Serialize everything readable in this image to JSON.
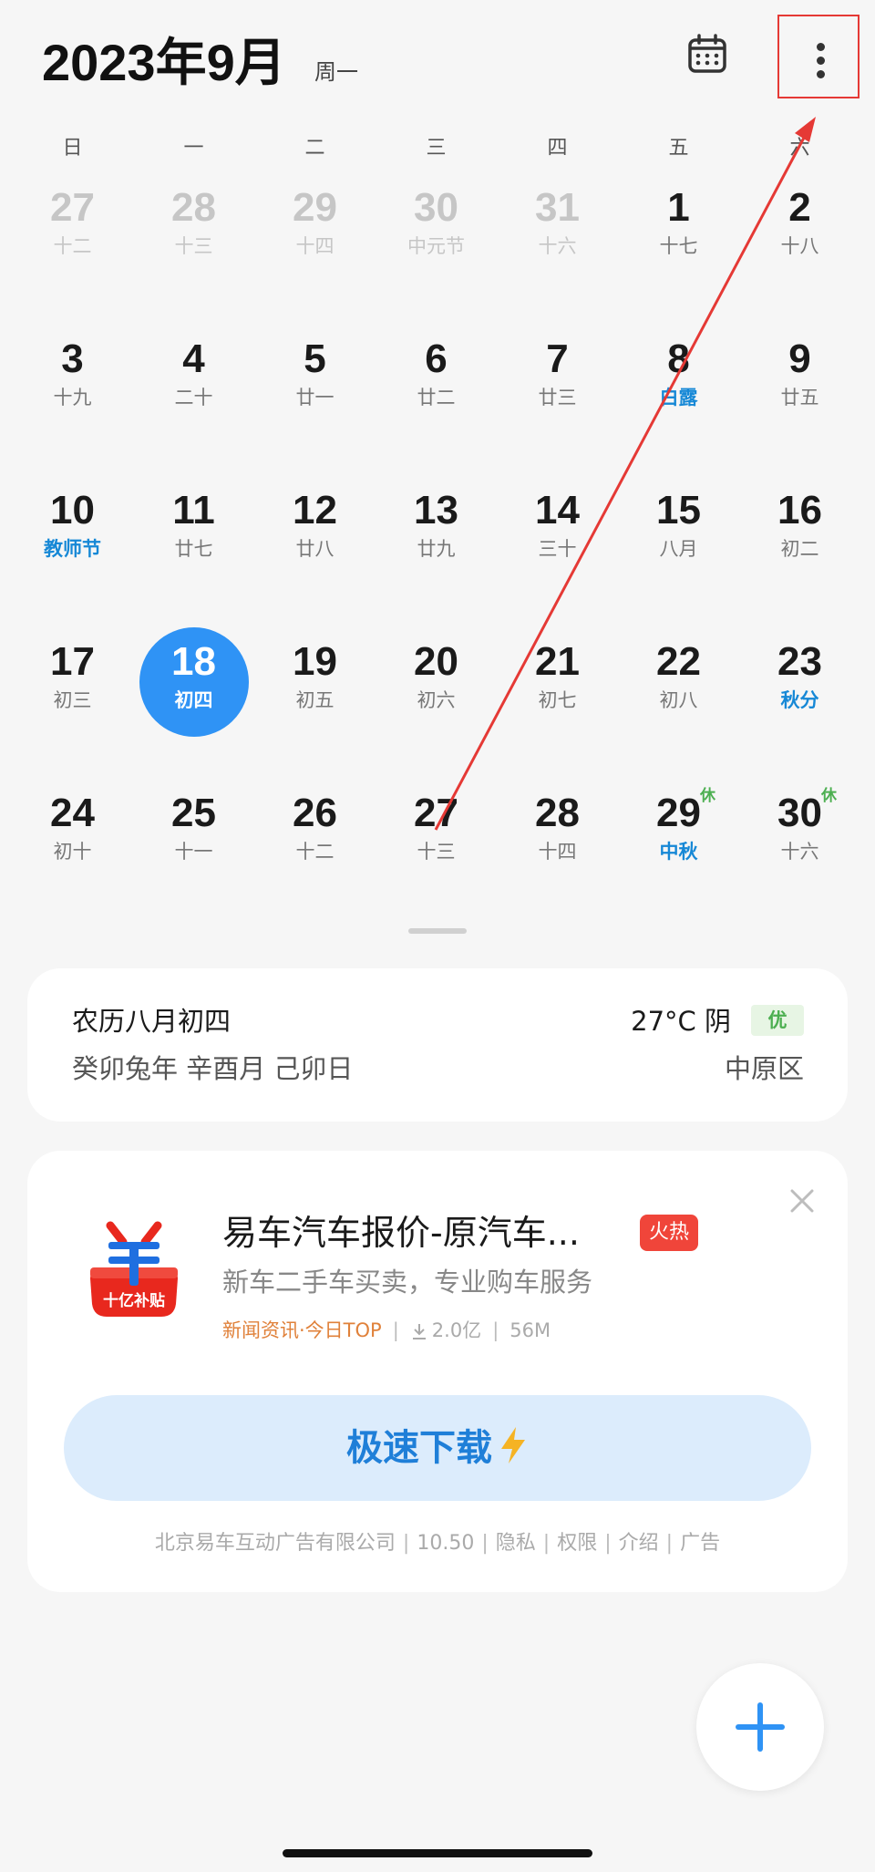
{
  "header": {
    "title": "2023年9月",
    "weekday": "周一"
  },
  "weekdays": [
    "日",
    "一",
    "二",
    "三",
    "四",
    "五",
    "六"
  ],
  "calendar": {
    "rows": [
      [
        {
          "day": "27",
          "sub": "十二",
          "out": true
        },
        {
          "day": "28",
          "sub": "十三",
          "out": true
        },
        {
          "day": "29",
          "sub": "十四",
          "out": true
        },
        {
          "day": "30",
          "sub": "中元节",
          "out": true
        },
        {
          "day": "31",
          "sub": "十六",
          "out": true
        },
        {
          "day": "1",
          "sub": "十七"
        },
        {
          "day": "2",
          "sub": "十八"
        }
      ],
      [
        {
          "day": "3",
          "sub": "十九"
        },
        {
          "day": "4",
          "sub": "二十"
        },
        {
          "day": "5",
          "sub": "廿一"
        },
        {
          "day": "6",
          "sub": "廿二"
        },
        {
          "day": "7",
          "sub": "廿三"
        },
        {
          "day": "8",
          "sub": "白露",
          "fest": true
        },
        {
          "day": "9",
          "sub": "廿五"
        }
      ],
      [
        {
          "day": "10",
          "sub": "教师节",
          "fest": true
        },
        {
          "day": "11",
          "sub": "廿七"
        },
        {
          "day": "12",
          "sub": "廿八"
        },
        {
          "day": "13",
          "sub": "廿九"
        },
        {
          "day": "14",
          "sub": "三十"
        },
        {
          "day": "15",
          "sub": "八月"
        },
        {
          "day": "16",
          "sub": "初二"
        }
      ],
      [
        {
          "day": "17",
          "sub": "初三"
        },
        {
          "day": "18",
          "sub": "初四",
          "today": true
        },
        {
          "day": "19",
          "sub": "初五"
        },
        {
          "day": "20",
          "sub": "初六"
        },
        {
          "day": "21",
          "sub": "初七"
        },
        {
          "day": "22",
          "sub": "初八"
        },
        {
          "day": "23",
          "sub": "秋分",
          "fest": true
        }
      ],
      [
        {
          "day": "24",
          "sub": "初十"
        },
        {
          "day": "25",
          "sub": "十一"
        },
        {
          "day": "26",
          "sub": "十二"
        },
        {
          "day": "27",
          "sub": "十三"
        },
        {
          "day": "28",
          "sub": "十四"
        },
        {
          "day": "29",
          "sub": "中秋",
          "fest": true,
          "rest": "休"
        },
        {
          "day": "30",
          "sub": "十六",
          "rest": "休"
        }
      ]
    ]
  },
  "info_card": {
    "lunar_date": "农历八月初四",
    "ganzhi": "癸卯兔年 辛酉月 己卯日",
    "weather": "27°C 阴",
    "aqi": "优",
    "district": "中原区"
  },
  "ad": {
    "title": "易车汽车报价-原汽车...",
    "hot_badge": "火热",
    "description": "新车二手车买卖，专业购车服务",
    "category": "新闻资讯·今日TOP",
    "downloads": "2.0亿",
    "size": "56M",
    "download_label": "极速下载",
    "icon_text": "十亿补贴",
    "footer": {
      "company": "北京易车互动广告有限公司",
      "version": "10.50",
      "privacy": "隐私",
      "permissions": "权限",
      "intro": "介绍",
      "ad_label": "广告"
    }
  },
  "colors": {
    "accent": "#2f93f5",
    "festival": "#1688d6",
    "rest": "#4caf50",
    "hot": "#f0453a",
    "annotation": "#e53935"
  }
}
